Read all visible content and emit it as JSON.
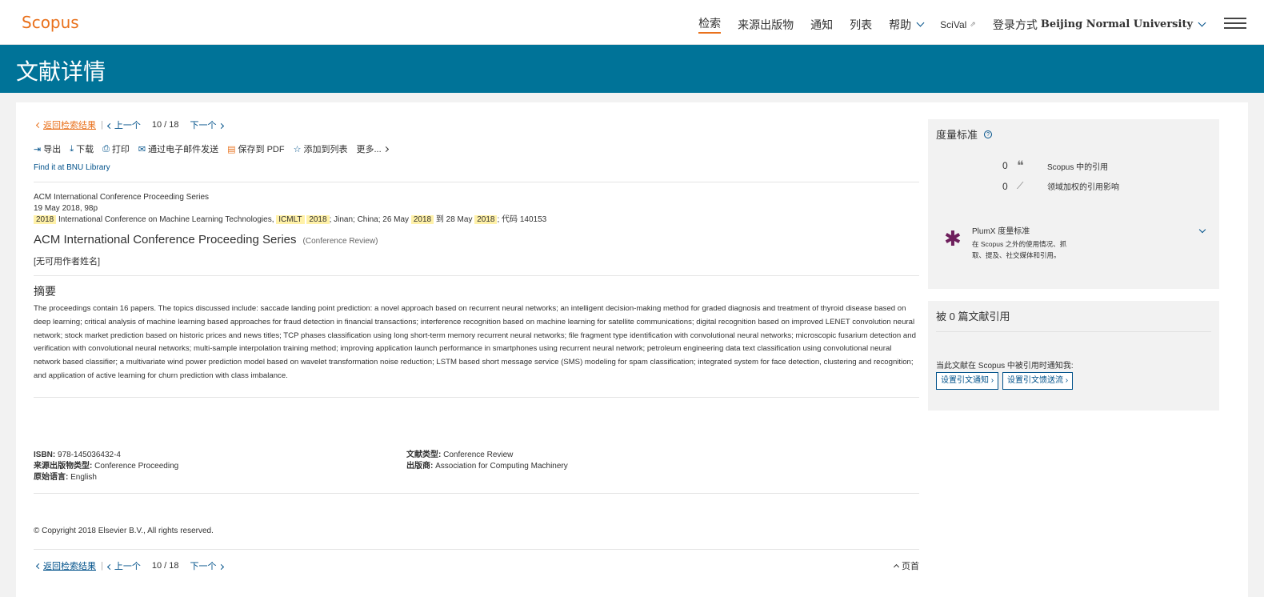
{
  "header": {
    "logo": "Scopus",
    "nav": {
      "search": "检索",
      "sources": "来源出版物",
      "alerts": "通知",
      "lists": "列表",
      "help": "帮助",
      "scival": "SciVal",
      "login_prefix": "登录方式",
      "institution": "Beijing Normal University"
    }
  },
  "band": {
    "title": "文献详情"
  },
  "pager": {
    "back": "返回检索结果",
    "prev": "上一个",
    "current": "10",
    "slash": "/",
    "total": "18",
    "next": "下一个"
  },
  "actions": {
    "export": "导出",
    "download": "下载",
    "print": "打印",
    "email": "通过电子邮件发送",
    "pdf": "保存到 PDF",
    "add_list": "添加到列表",
    "more": "更多..."
  },
  "findit": "Find it at BNU Library",
  "source": {
    "series": "ACM International Conference Proceeding Series",
    "date": "19 May 2018, 98p",
    "conf": {
      "year1": "2018",
      "name": "International Conference on Machine Learning Technologies,",
      "acr": "ICMLT",
      "year2": "2018",
      "location": "; Jinan; China; 26 May",
      "year3": "2018",
      "to": "到 28 May",
      "year4": "2018",
      "code": "; 代码 140153"
    }
  },
  "document": {
    "title": "ACM International Conference Proceeding Series",
    "type": "(Conference Review)",
    "authors": "[无可用作者姓名]"
  },
  "abstract": {
    "heading": "摘要",
    "text": "The proceedings contain 16 papers. The topics discussed include: saccade landing point prediction: a novel approach based on recurrent neural networks; an intelligent decision-making method for graded diagnosis and treatment of thyroid disease based on deep learning; critical analysis of machine learning based approaches for fraud detection in financial transactions; interference recognition based on machine learning for satellite communications; digital recognition based on improved LENET convolution neural network; stock market prediction based on historic prices and news titles; TCP phases classification using long short-term memory recurrent neural networks; file fragment type identification with convolutional neural networks; microscopic fusarium detection and verification with convolutional neural networks; multi-sample interpolation training method; improving application launch performance in smartphones using recurrent neural network; petroleum engineering data text classification using convolutional neural network based classifier; a multivariate wind power prediction model based on wavelet transformation noise reduction; LSTM based short message service (SMS) modeling for spam classification; integrated system for face detection, clustering and recognition; and application of active learning for churn prediction with class imbalance."
  },
  "meta": {
    "isbn_label": "ISBN:",
    "isbn": "978-145036432-4",
    "source_type_label": "来源出版物类型:",
    "source_type": "Conference Proceeding",
    "language_label": "原始语言:",
    "language": "English",
    "doc_type_label": "文献类型:",
    "doc_type": "Conference Review",
    "publisher_label": "出版商:",
    "publisher": "Association for Computing Machinery"
  },
  "copyright": "© Copyright 2018 Elsevier B.V., All rights reserved.",
  "top_link": "页首",
  "metrics": {
    "heading": "度量标准",
    "citations_count": "0",
    "citations_label": "Scopus 中的引用",
    "fwci_count": "0",
    "fwci_label": "领域加权的引用影响",
    "plumx_title": "PlumX 度量标准",
    "plumx_desc": "在 Scopus 之外的使用情况、抓取、提及、社交媒体和引用。"
  },
  "cited_by": {
    "heading": "被 0 篇文献引用",
    "note": "当此文献在 Scopus 中被引用时通知我:",
    "alert_btn": "设置引文通知",
    "feed_btn": "设置引文馈送流"
  },
  "colors": {
    "accent": "#e9711c",
    "band": "#007398",
    "link": "#00518a"
  }
}
